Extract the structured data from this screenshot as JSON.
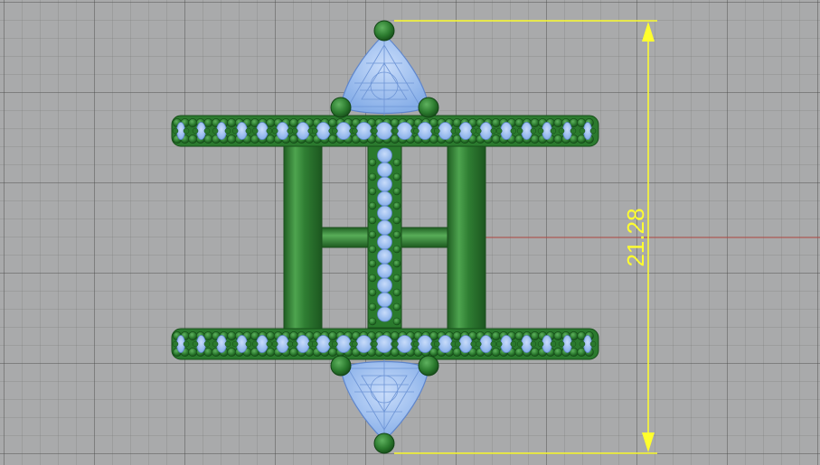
{
  "viewport": {
    "background_color": "#a9aaab",
    "grid_color": "#8f9091"
  },
  "model": {
    "metal_color": "#2f7d32",
    "metal_light": "#4aa04a",
    "metal_dark": "#1c5a1f",
    "stone_color": "#8fb7ee",
    "wire_color": "#6e95d6"
  },
  "dimension": {
    "label": "21.28",
    "color": "#ffff2e"
  },
  "x_axis_color": "#b44a44"
}
